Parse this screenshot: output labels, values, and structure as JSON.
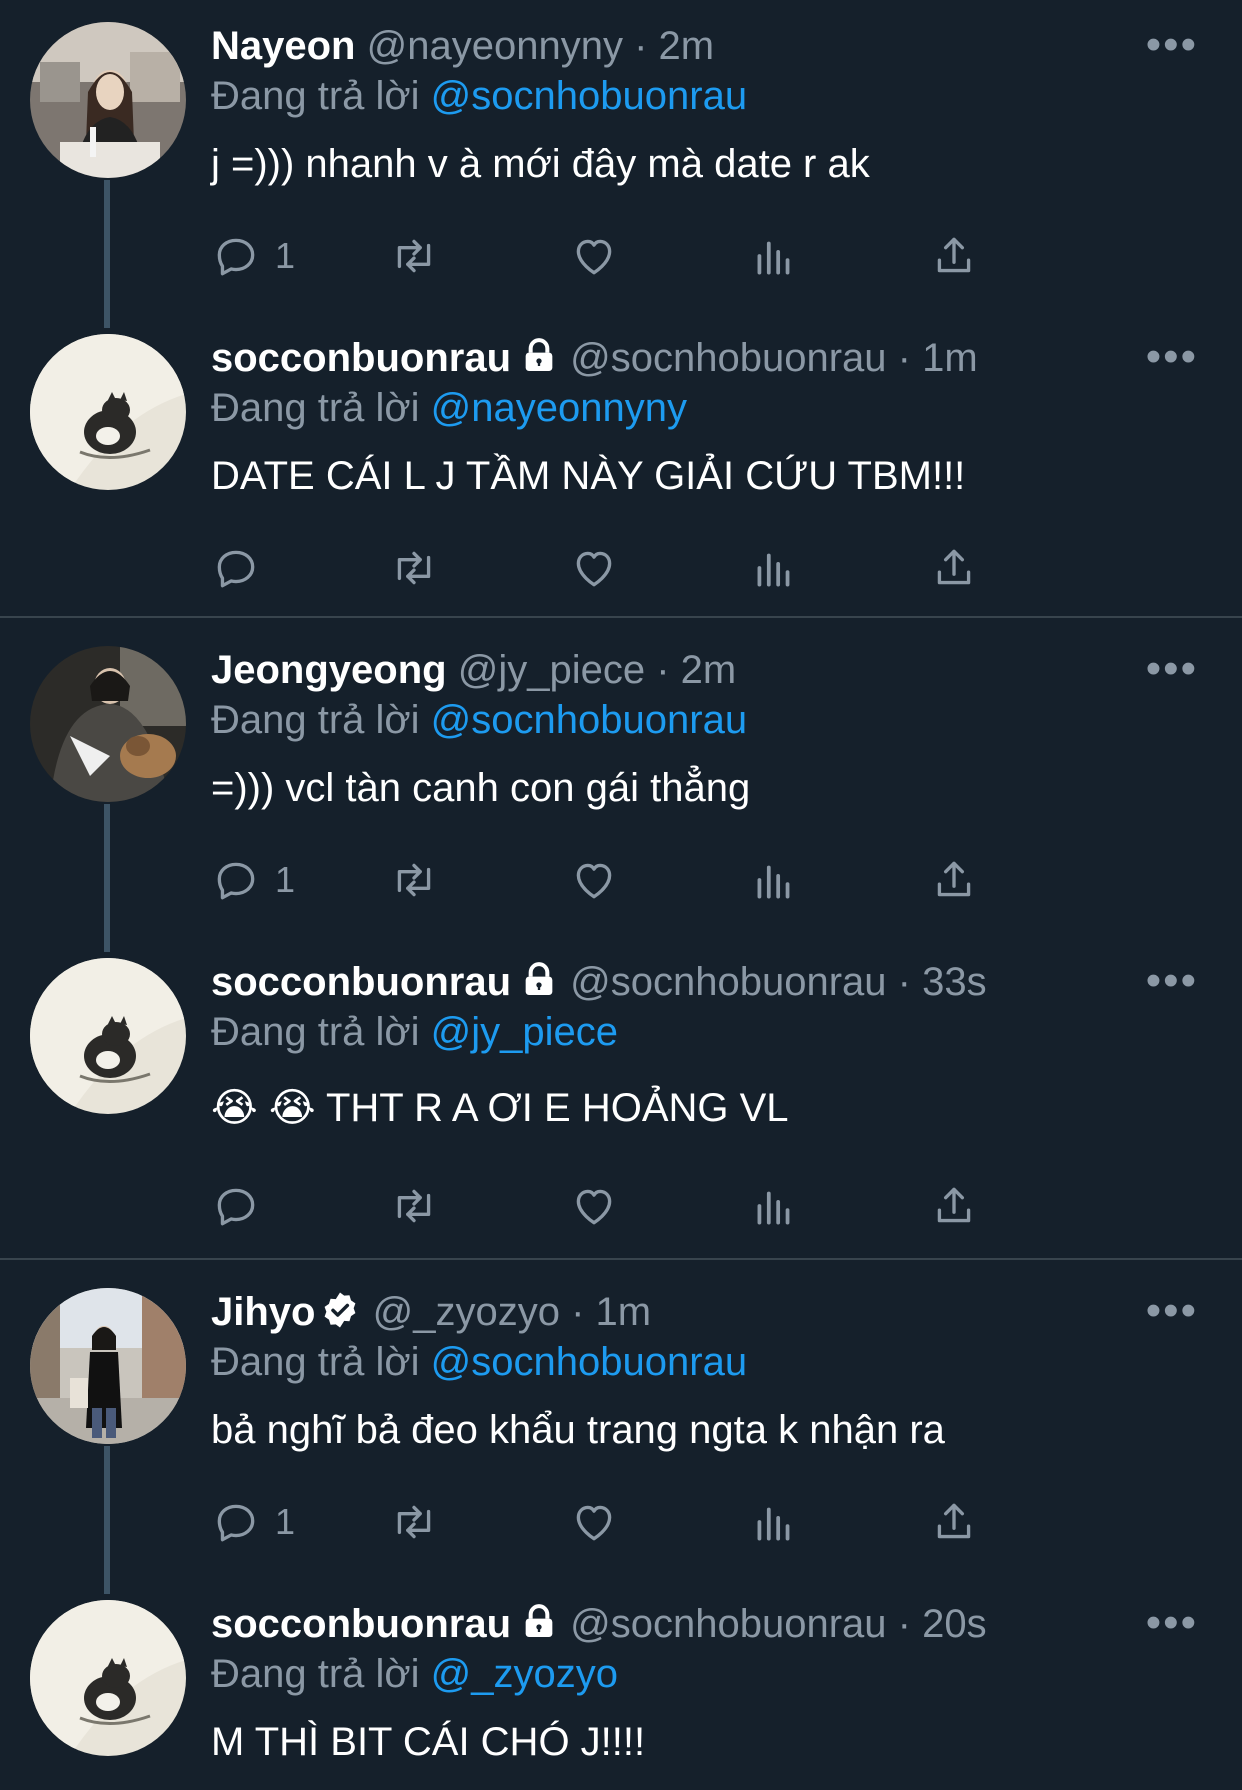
{
  "colors": {
    "background": "#15202b",
    "text_primary": "#ffffff",
    "text_secondary": "#8b98a5",
    "mention": "#1d9bf0",
    "thread_line": "#3d5466",
    "separator": "#38444d"
  },
  "reply_prefix": "Đang trả lời",
  "more_label": "•••",
  "tweets": [
    {
      "name": "Nayeon",
      "handle": "@nayeonnyny",
      "time": "· 2m",
      "reply_to": "@socnhobuonrau",
      "text": "j =))) nhanh v à mới đây mà date r ak",
      "reply_count": "1",
      "locked": false,
      "verified": false
    },
    {
      "name": "socconbuonrau",
      "handle": "@socnhobuonrau",
      "time": "· 1m",
      "reply_to": "@nayeonnyny",
      "text": "DATE CÁI L J TẦM NÀY GIẢI CỨU TBM!!!",
      "reply_count": "",
      "locked": true,
      "verified": false
    },
    {
      "name": "Jeongyeong",
      "handle": "@jy_piece",
      "time": "· 2m",
      "reply_to": "@socnhobuonrau",
      "text": "=))) vcl tàn canh con gái thẳng",
      "reply_count": "1",
      "locked": false,
      "verified": false
    },
    {
      "name": "socconbuonrau",
      "handle": "@socnhobuonrau",
      "time": "· 33s",
      "reply_to": "@jy_piece",
      "text": "😭 😭  THT R A ƠI E HOẢNG VL",
      "reply_count": "",
      "locked": true,
      "verified": false
    },
    {
      "name": "Jihyo",
      "handle": "@_zyozyo",
      "time": "· 1m",
      "reply_to": "@socnhobuonrau",
      "text": "bả nghĩ bả đeo khẩu trang ngta k nhận ra",
      "reply_count": "1",
      "locked": false,
      "verified": true
    },
    {
      "name": "socconbuonrau",
      "handle": "@socnhobuonrau",
      "time": "· 20s",
      "reply_to": "@_zyozyo",
      "text": "M THÌ BIT CÁI CHÓ J!!!!",
      "reply_count": "",
      "locked": true,
      "verified": false
    }
  ]
}
